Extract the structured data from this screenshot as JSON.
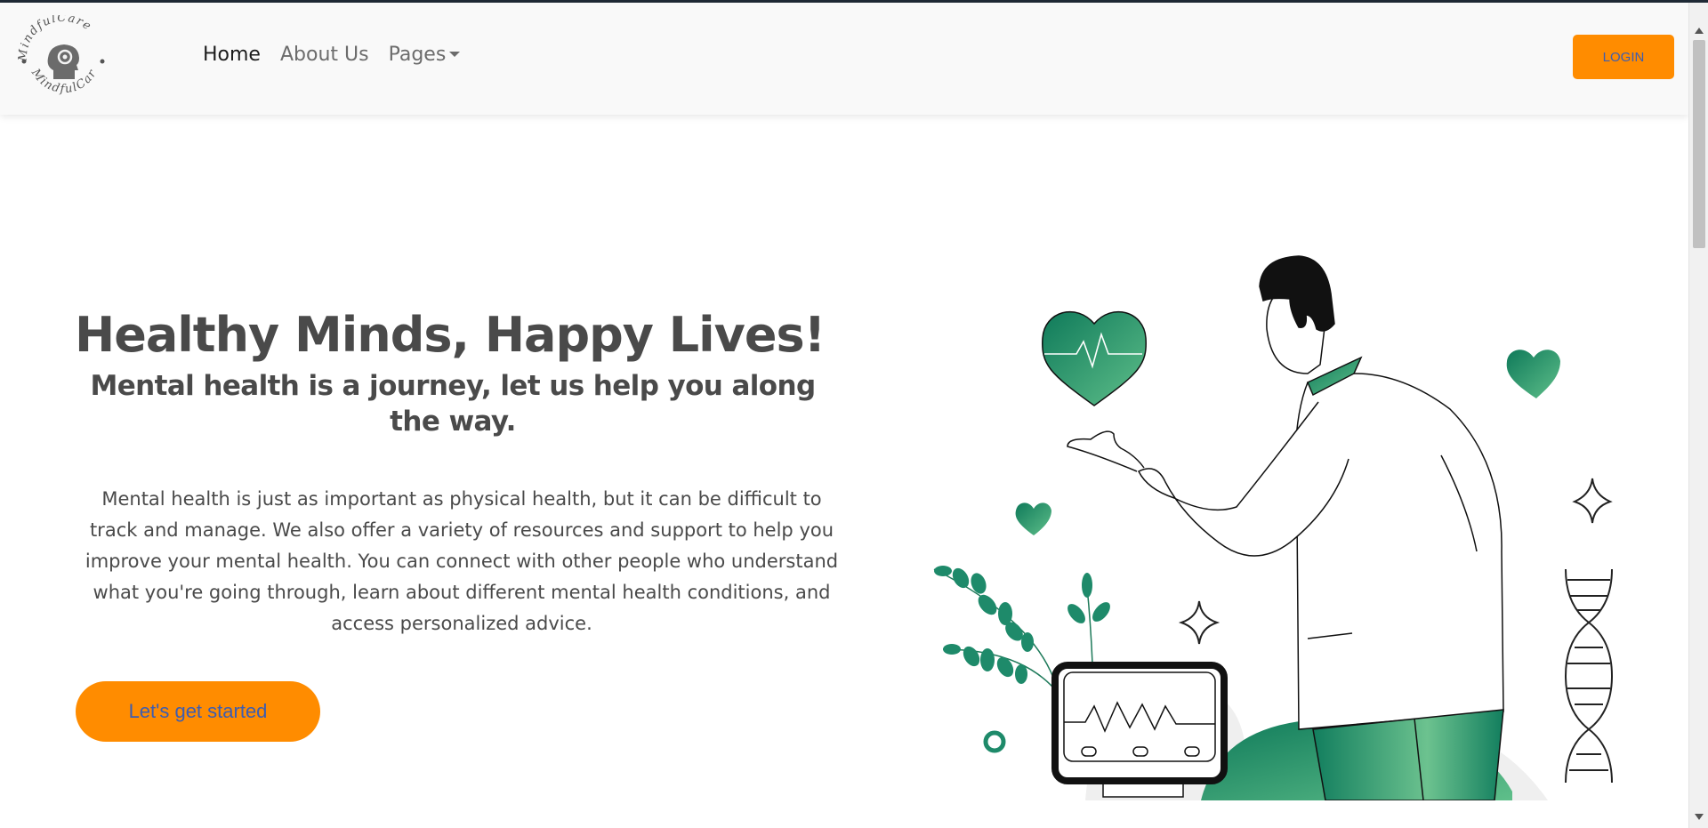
{
  "nav": {
    "logo_text": "MindfulCare",
    "links": [
      {
        "label": "Home",
        "active": true
      },
      {
        "label": "About Us",
        "active": false
      },
      {
        "label": "Pages",
        "active": false
      }
    ],
    "login_label": "LOGIN"
  },
  "hero": {
    "title": "Healthy Minds, Happy Lives!",
    "subtitle": "Mental health is a journey, let us help you along the way.",
    "description": "Mental health is just as important as physical health, but it can be difficult to track and manage. We also offer a variety of resources and support to help you improve your mental health. You can connect with other people who understand what you're going through, learn about different mental health conditions, and access personalized advice.",
    "cta_label": "Let's get started"
  },
  "colors": {
    "accent": "#ff8c00",
    "button_text": "#3d5db0",
    "illustration_green": "#1e8a6a",
    "heading": "#4a4a4a"
  }
}
